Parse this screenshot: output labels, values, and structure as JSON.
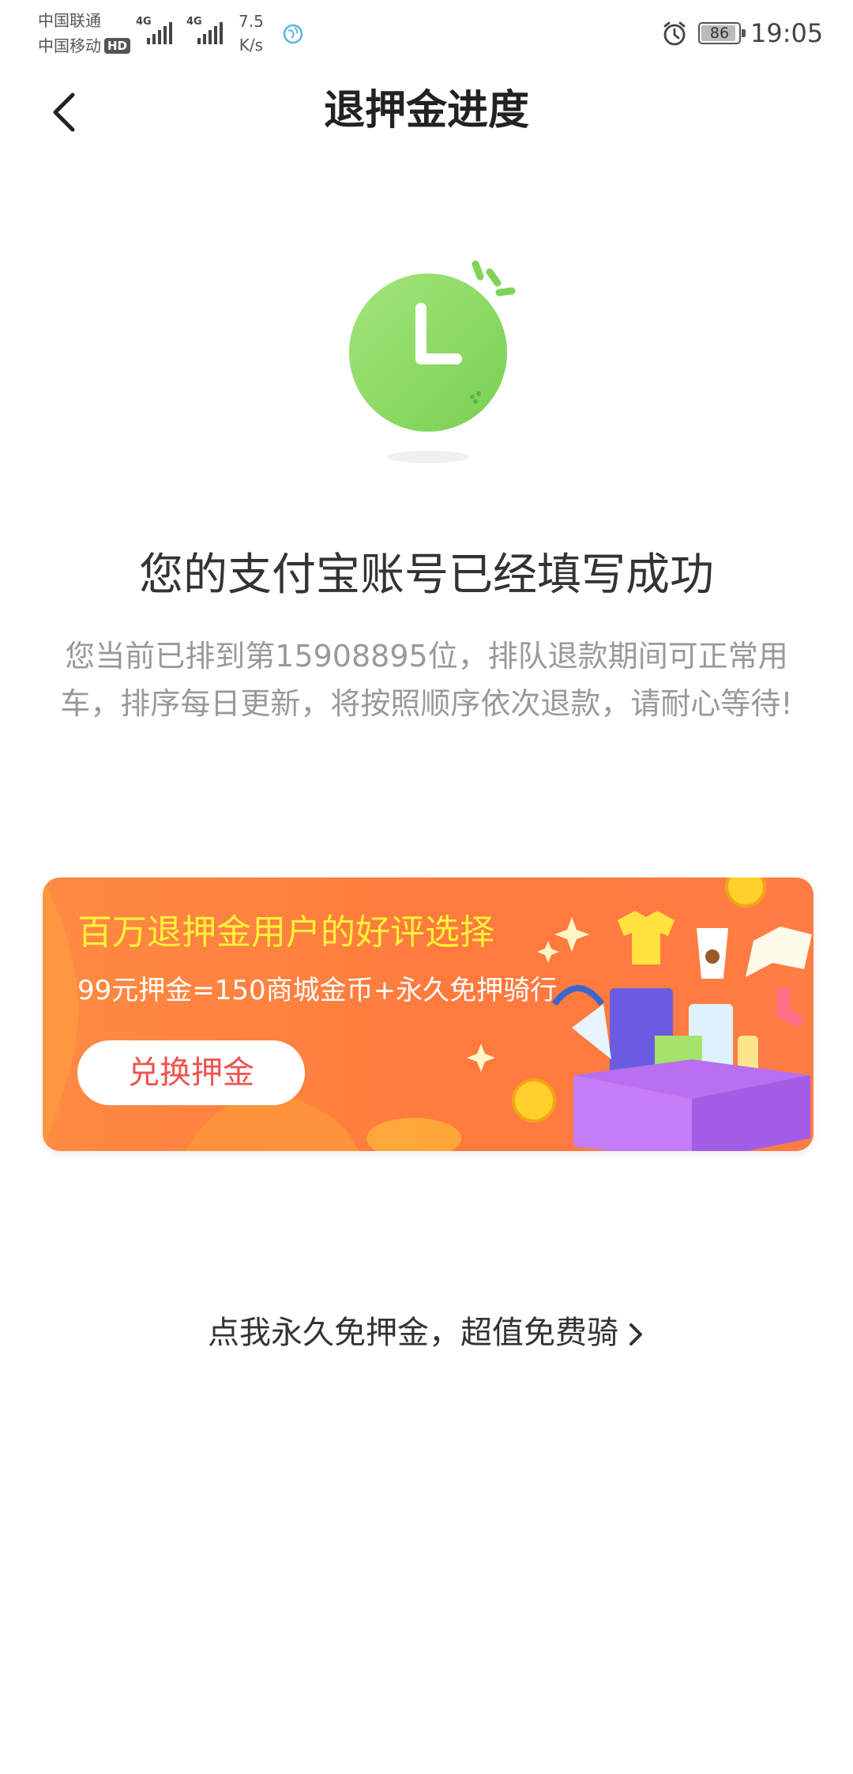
{
  "status_bar": {
    "carrier_1": "中国联通",
    "carrier_2": "中国移动",
    "hd": "HD",
    "network_1": "4G",
    "network_2": "4G",
    "speed_value": "7.5",
    "speed_unit": "K/s",
    "battery": "86",
    "time": "19:05"
  },
  "header": {
    "title": "退押金进度"
  },
  "status": {
    "title": "您的支付宝账号已经填写成功",
    "message": "您当前已排到第15908895位，排队退款期间可正常用车，排序每日更新，将按照顺序依次退款，请耐心等待!"
  },
  "banner": {
    "headline": "百万退押金用户的好评选择",
    "offer": "99元押金=150商城金币+永久免押骑行",
    "button_label": "兑换押金"
  },
  "footer_link": {
    "label": "点我永久免押金，超值免费骑"
  },
  "colors": {
    "accent_green": "#8dd95f",
    "banner_orange": "#ff7f3f",
    "banner_headline": "#fff23a",
    "button_text": "#f0524f"
  }
}
